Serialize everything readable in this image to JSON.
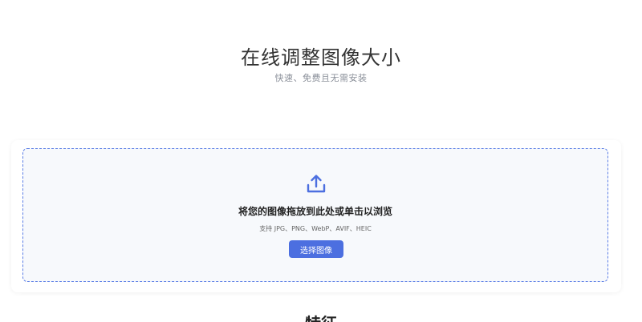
{
  "hero": {
    "title": "在线调整图像大小",
    "subtitle": "快速、免费且无需安装"
  },
  "upload": {
    "icon": "upload-icon",
    "title": "将您的图像拖放到此处或单击以浏览",
    "formats": "支持 JPG、PNG、WebP、AVIF、HEIC",
    "button_label": "选择图像"
  },
  "features": {
    "heading": "特征"
  },
  "colors": {
    "accent": "#4c6fe0",
    "dropzone_border": "#5b7ee6",
    "dropzone_bg": "#f7f9fc"
  }
}
